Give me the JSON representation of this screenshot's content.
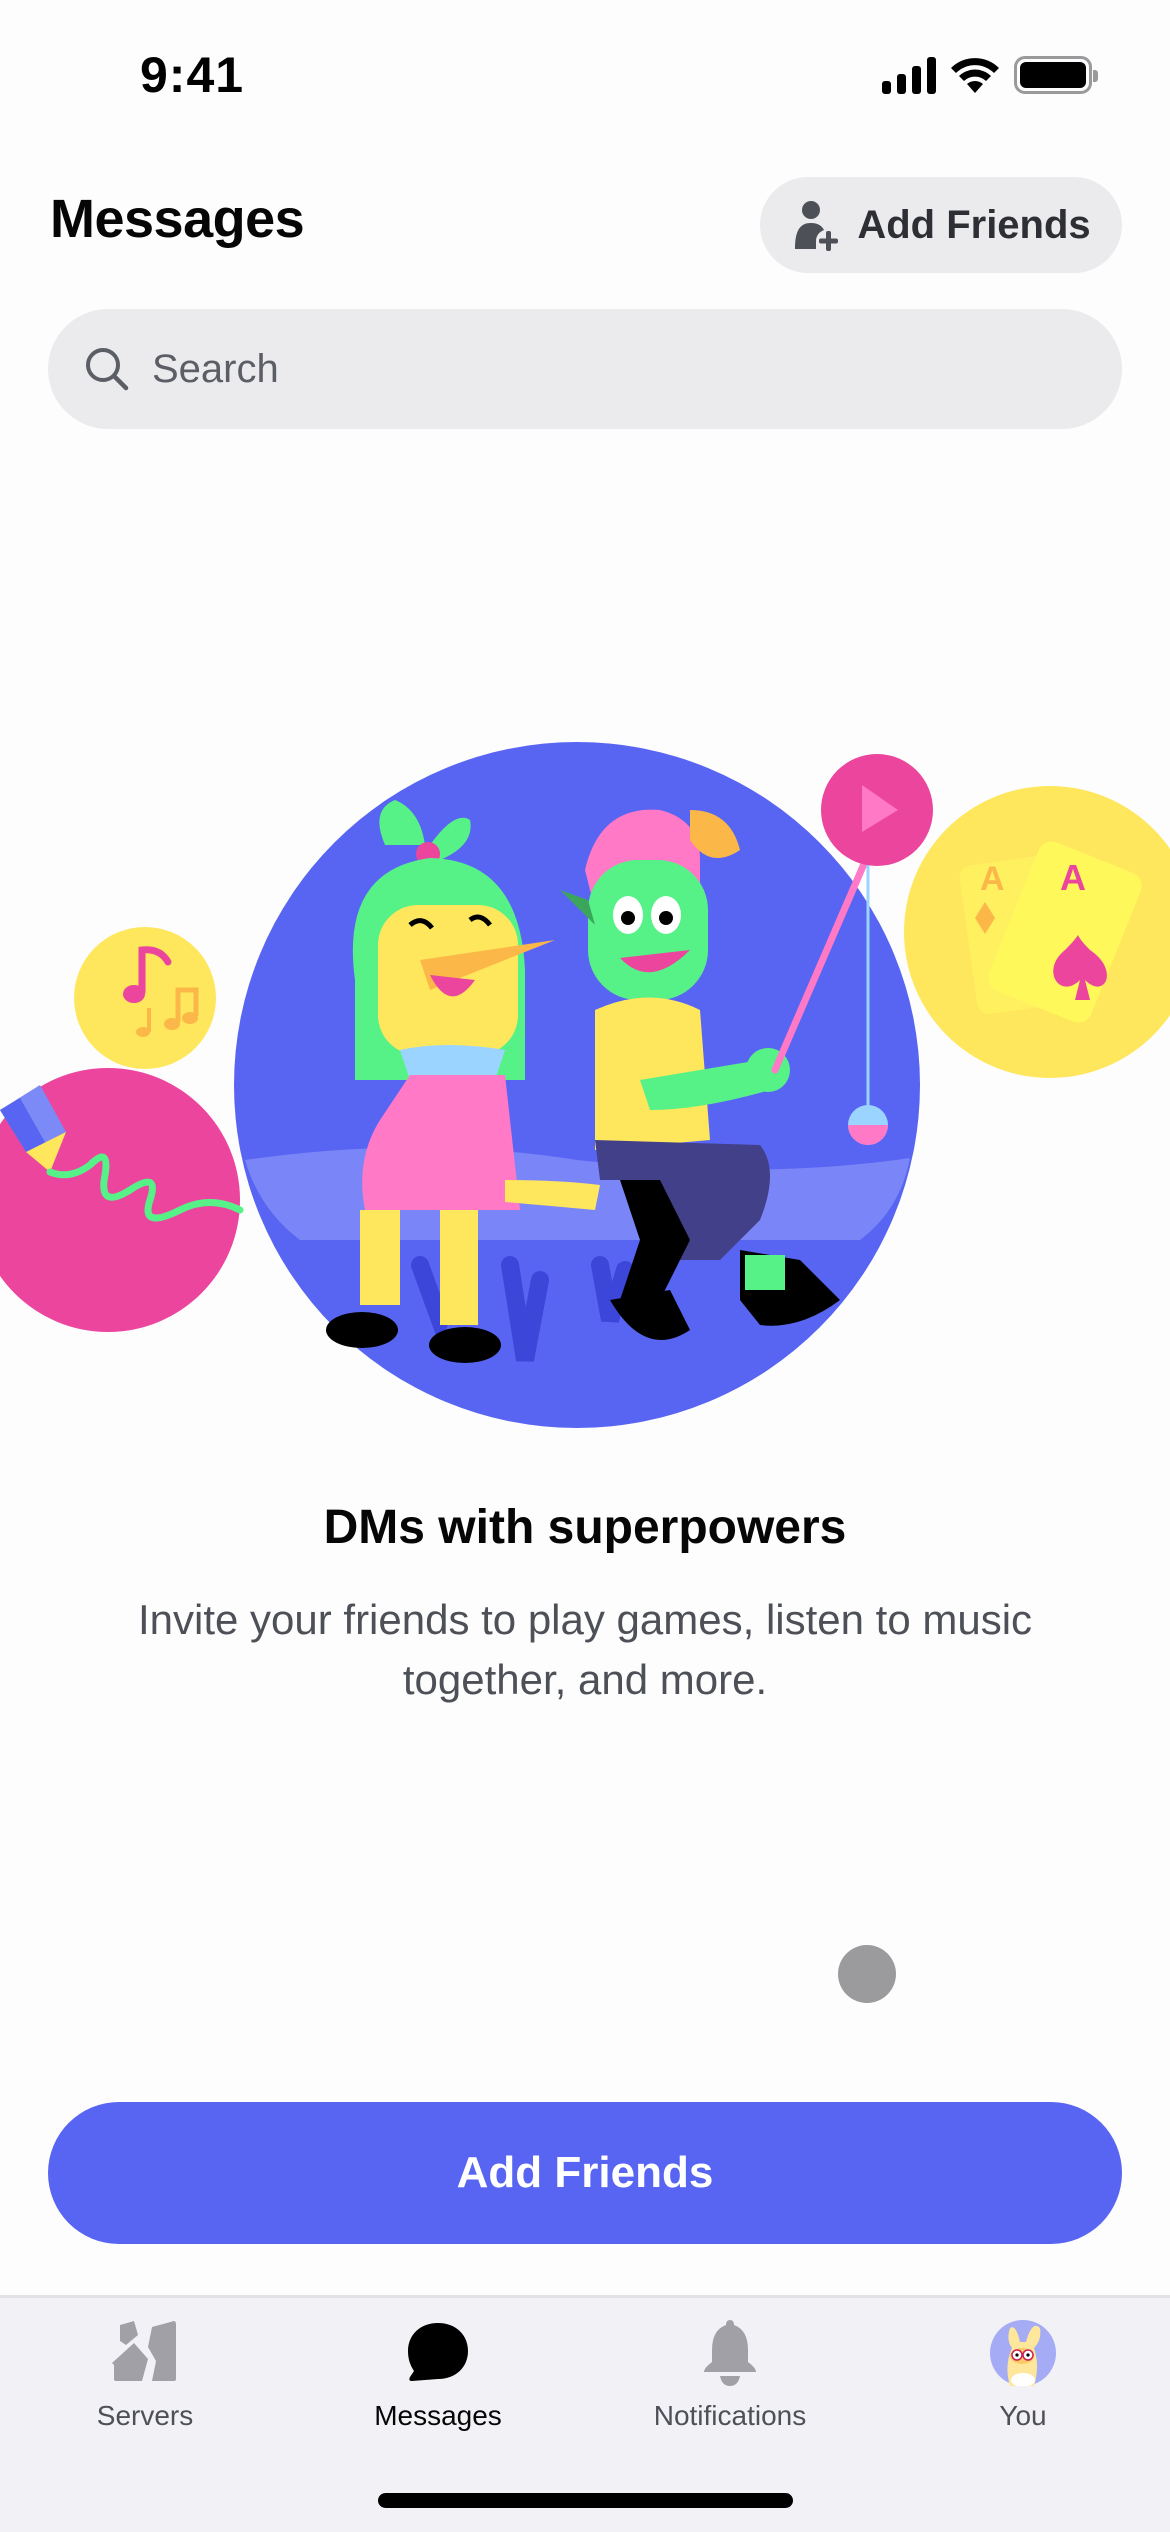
{
  "status_bar": {
    "time": "9:41",
    "icons": [
      "cellular-signal-icon",
      "wifi-icon",
      "battery-icon"
    ]
  },
  "header": {
    "title": "Messages",
    "add_friends_button": {
      "label": "Add Friends",
      "icon": "add-user-icon"
    }
  },
  "search": {
    "placeholder": "Search",
    "value": "",
    "icon": "search-icon"
  },
  "illustration": {
    "description": "Two cartoon characters sitting together, surrounded by bubbles for music, drawing, video and playing cards",
    "bubbles": [
      "music-notes-icon",
      "pencil-drawing-icon",
      "play-icon",
      "playing-cards-icon"
    ],
    "card_labels": [
      "A",
      "A"
    ],
    "colors": {
      "main_circle": "#5865f2",
      "pink": "#eb459e",
      "yellow": "#fee75c",
      "green": "#57f287"
    }
  },
  "empty_state": {
    "title": "DMs with superpowers",
    "body": "Invite your friends to play games, listen to music together, and more."
  },
  "primary_action": {
    "label": "Add Friends"
  },
  "tab_bar": {
    "tabs": [
      {
        "label": "Servers",
        "icon": "servers-icon",
        "active": false
      },
      {
        "label": "Messages",
        "icon": "chat-bubble-icon",
        "active": true
      },
      {
        "label": "Notifications",
        "icon": "bell-icon",
        "active": false
      },
      {
        "label": "You",
        "icon": "avatar",
        "active": false
      }
    ]
  },
  "colors": {
    "brand": "#5865f2",
    "surface": "#ebebee",
    "tab_bar_bg": "#f2f2f6",
    "text_primary": "#060607",
    "text_muted": "#4e5058"
  }
}
